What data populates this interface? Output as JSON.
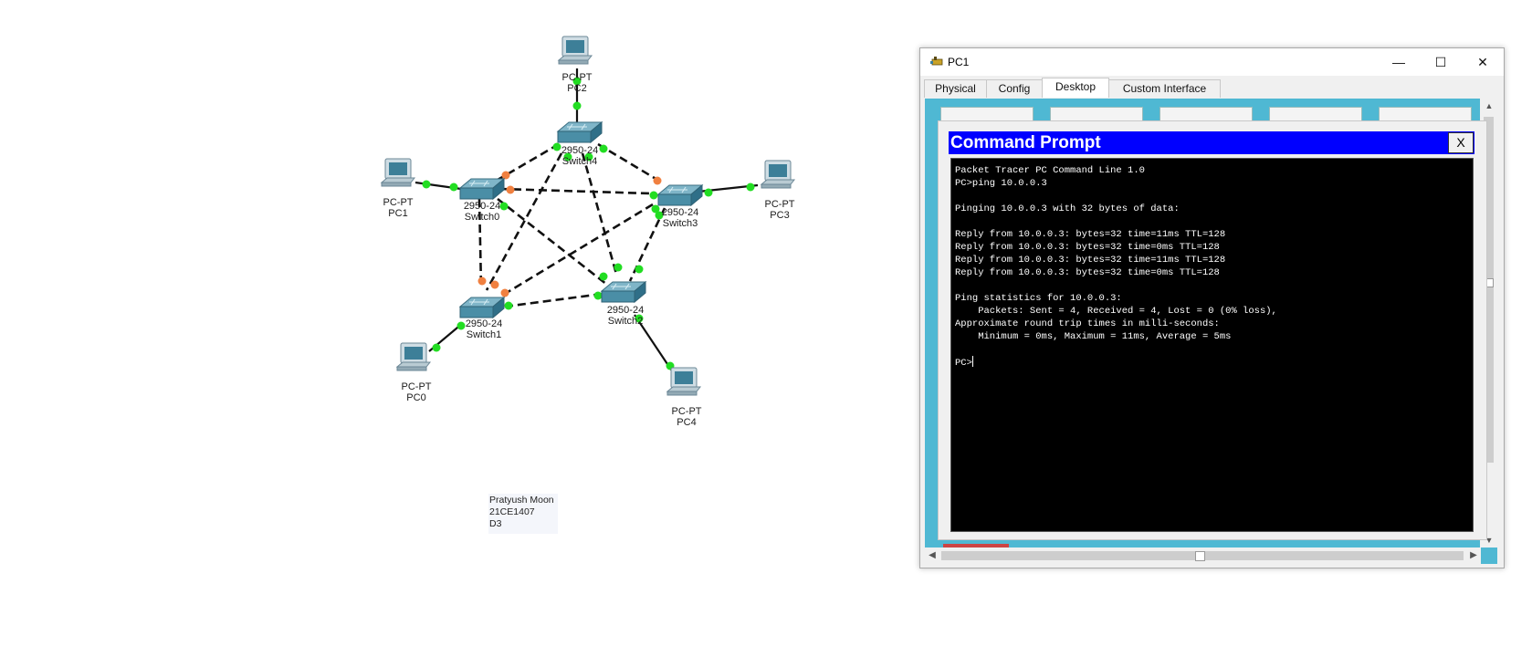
{
  "topology": {
    "devices": [
      {
        "id": "pc2",
        "kind": "pc",
        "model": "PC-PT",
        "name": "PC2"
      },
      {
        "id": "switch4",
        "kind": "switch",
        "model": "2950-24",
        "name": "Switch4"
      },
      {
        "id": "pc1",
        "kind": "pc",
        "model": "PC-PT",
        "name": "PC1"
      },
      {
        "id": "switch0",
        "kind": "switch",
        "model": "2950-24",
        "name": "Switch0"
      },
      {
        "id": "switch3",
        "kind": "switch",
        "model": "2950-24",
        "name": "Switch3"
      },
      {
        "id": "pc3",
        "kind": "pc",
        "model": "PC-PT",
        "name": "PC3"
      },
      {
        "id": "switch1",
        "kind": "switch",
        "model": "2950-24",
        "name": "Switch1"
      },
      {
        "id": "switch2",
        "kind": "switch",
        "model": "2950-24",
        "name": "Switch2"
      },
      {
        "id": "pc0",
        "kind": "pc",
        "model": "PC-PT",
        "name": "PC0"
      },
      {
        "id": "pc4",
        "kind": "pc",
        "model": "PC-PT",
        "name": "PC4"
      }
    ],
    "link_colors": {
      "up": "#22dd22",
      "blocking": "#f08040",
      "cable": "#111111"
    }
  },
  "note": {
    "lines": [
      "Pratyush Moon",
      "21CE1407",
      "D3"
    ]
  },
  "window": {
    "title": "PC1",
    "tabs": [
      {
        "label": "Physical",
        "active": false
      },
      {
        "label": "Config",
        "active": false
      },
      {
        "label": "Desktop",
        "active": true
      },
      {
        "label": "Custom Interface",
        "active": false
      }
    ],
    "buttons": {
      "minimize": "—",
      "maximize": "☐",
      "close": "✕"
    }
  },
  "command_prompt": {
    "title": "Command Prompt",
    "close_label": "X",
    "lines": [
      "Packet Tracer PC Command Line 1.0",
      "PC>ping 10.0.0.3",
      "",
      "Pinging 10.0.0.3 with 32 bytes of data:",
      "",
      "Reply from 10.0.0.3: bytes=32 time=11ms TTL=128",
      "Reply from 10.0.0.3: bytes=32 time=0ms TTL=128",
      "Reply from 10.0.0.3: bytes=32 time=11ms TTL=128",
      "Reply from 10.0.0.3: bytes=32 time=0ms TTL=128",
      "",
      "Ping statistics for 10.0.0.3:",
      "    Packets: Sent = 4, Received = 4, Lost = 0 (0% loss),",
      "Approximate round trip times in milli-seconds:",
      "    Minimum = 0ms, Maximum = 11ms, Average = 5ms",
      ""
    ],
    "prompt": "PC>"
  }
}
